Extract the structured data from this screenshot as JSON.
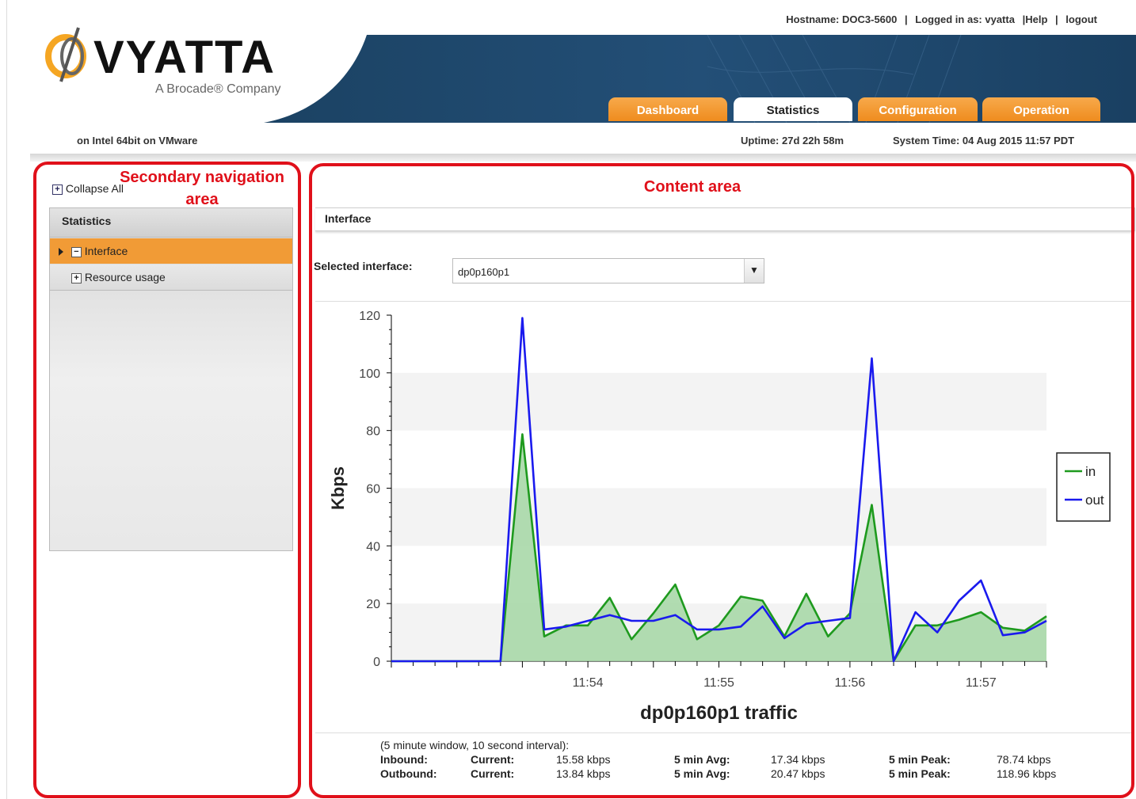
{
  "header": {
    "hostname": "Hostname: DOC3-5600",
    "sep": "|",
    "logged_in": "Logged in as: vyatta",
    "help": "|Help",
    "logout": "logout",
    "logo_text": "VYATTA",
    "logo_sub": "A Brocade® Company",
    "platform": "on Intel 64bit on VMware",
    "uptime": "Uptime: 27d 22h 58m",
    "system_time": "System Time: 04 Aug 2015 11:57 PDT",
    "tabs": [
      "Dashboard",
      "Statistics",
      "Configuration",
      "Operation"
    ],
    "active_tab": "Statistics",
    "tab_color": "#f0921f",
    "banner_color": "#1d4a70"
  },
  "sidebar": {
    "collapse_all": "Collapse All",
    "section": "Statistics",
    "items": [
      "Interface",
      "Resource usage"
    ],
    "selected_item": "Interface",
    "selected_color": "#f19b36"
  },
  "content": {
    "title": "Interface",
    "selected_interface_label": "Selected interface:",
    "selected_interface_value": "dp0p160p1"
  },
  "chart_data": {
    "type": "area",
    "title": "dp0p160p1 traffic",
    "ylabel": "Kbps",
    "xlabel": "",
    "ylim": [
      0,
      120
    ],
    "yticks": [
      0,
      20,
      40,
      60,
      80,
      100,
      120
    ],
    "x_tick_labels": [
      "11:54",
      "11:55",
      "11:56",
      "11:57"
    ],
    "x_tick_label_index": [
      9,
      15,
      21,
      27
    ],
    "grid": "alternating horizontal bands",
    "legend_position": "right",
    "series": [
      {
        "name": "in",
        "color": "#1e9a1e",
        "filled": true,
        "values": [
          0,
          0,
          0,
          0,
          0,
          0,
          78.7,
          8.6,
          12.4,
          12.4,
          22,
          7.6,
          16.6,
          26.6,
          7.6,
          12.4,
          22.4,
          21,
          8.6,
          23.4,
          8.6,
          16.6,
          54.2,
          0,
          12.4,
          12.4,
          14.4,
          17,
          11.6,
          10.6,
          15.6
        ]
      },
      {
        "name": "out",
        "color": "#1a1aee",
        "filled": false,
        "values": [
          0,
          0,
          0,
          0,
          0,
          0,
          119,
          11,
          12,
          14,
          16,
          14,
          14,
          16,
          11,
          11,
          12,
          19,
          8,
          13,
          14,
          15,
          105,
          0,
          17,
          10,
          21,
          28,
          9,
          10,
          14
        ]
      }
    ]
  },
  "stats": {
    "caption": "(5 minute window, 10 second interval):",
    "rows": [
      {
        "label": "Inbound:",
        "current_label": "Current:",
        "current": "15.58 kbps",
        "avg_label": "5 min Avg:",
        "avg": "17.34 kbps",
        "peak_label": "5 min Peak:",
        "peak": "78.74 kbps"
      },
      {
        "label": "Outbound:",
        "current_label": "Current:",
        "current": "13.84 kbps",
        "avg_label": "5 min Avg:",
        "avg": "20.47 kbps",
        "peak_label": "5 min Peak:",
        "peak": "118.96 kbps"
      }
    ]
  },
  "annotations": {
    "nav": "Secondary navigation area",
    "content": "Content area",
    "color": "#e0101a"
  }
}
